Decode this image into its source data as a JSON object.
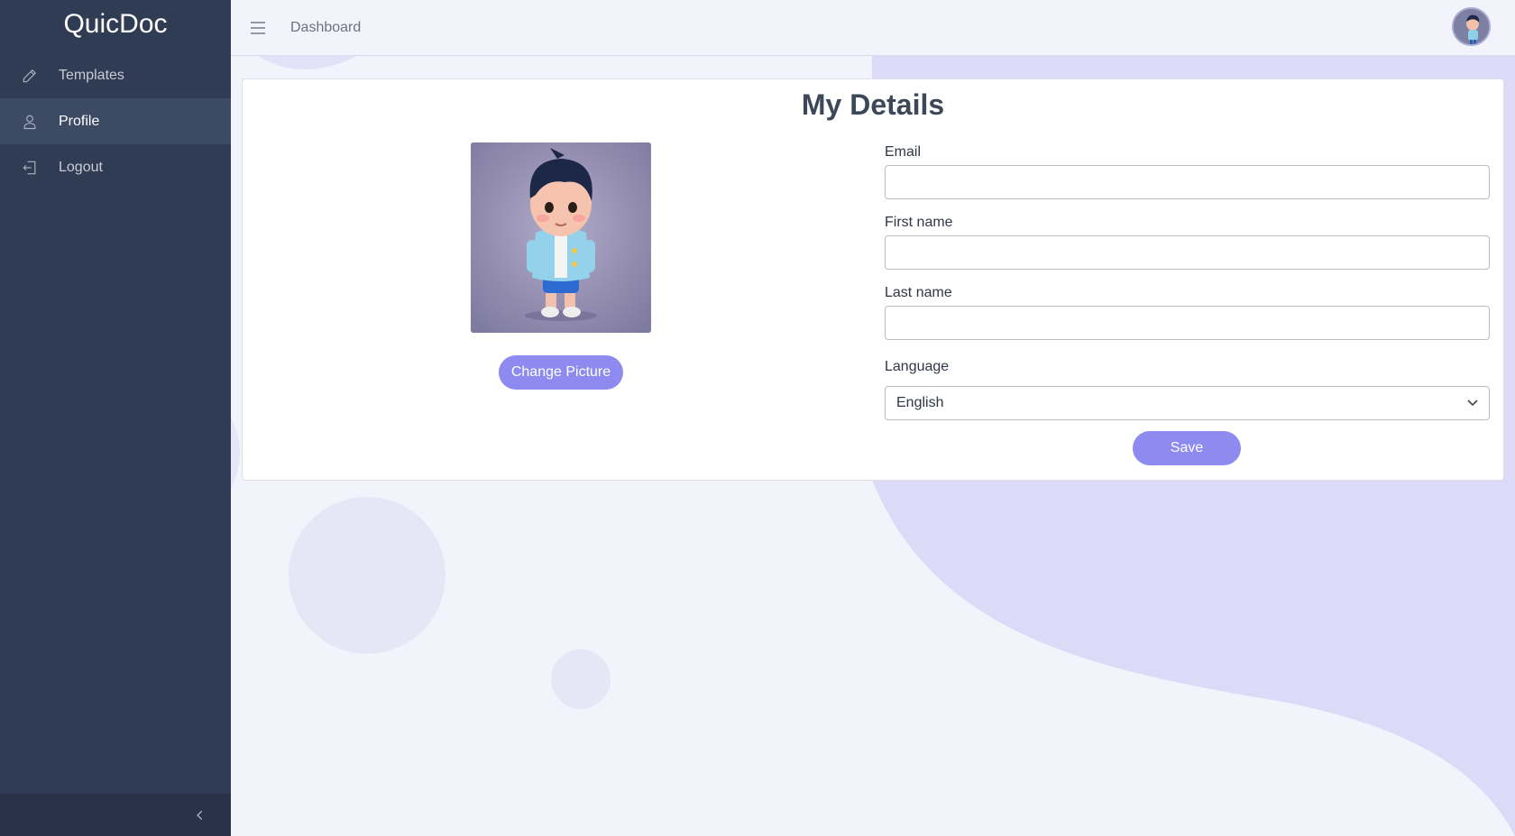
{
  "app": {
    "brand": "QuicDoc"
  },
  "sidebar": {
    "items": [
      {
        "label": "Templates",
        "icon": "pencil-icon",
        "active": false
      },
      {
        "label": "Profile",
        "icon": "user-icon",
        "active": true
      },
      {
        "label": "Logout",
        "icon": "logout-icon",
        "active": false
      }
    ],
    "collapse_icon": "chevron-left-icon"
  },
  "header": {
    "menu_icon": "hamburger-icon",
    "breadcrumb": "Dashboard",
    "avatar_icon": "avatar"
  },
  "card": {
    "title": "My Details",
    "change_picture_label": "Change Picture",
    "form": {
      "email": {
        "label": "Email",
        "value": "",
        "placeholder": ""
      },
      "first_name": {
        "label": "First name",
        "value": "",
        "placeholder": ""
      },
      "last_name": {
        "label": "Last name",
        "value": "",
        "placeholder": ""
      },
      "language": {
        "label": "Language",
        "value": "English"
      }
    },
    "save_label": "Save"
  },
  "colors": {
    "sidebar_bg": "#303c54",
    "accent": "#8e8bf0",
    "page_bg": "#f3f3fb",
    "decor": "#dcdaf6"
  }
}
